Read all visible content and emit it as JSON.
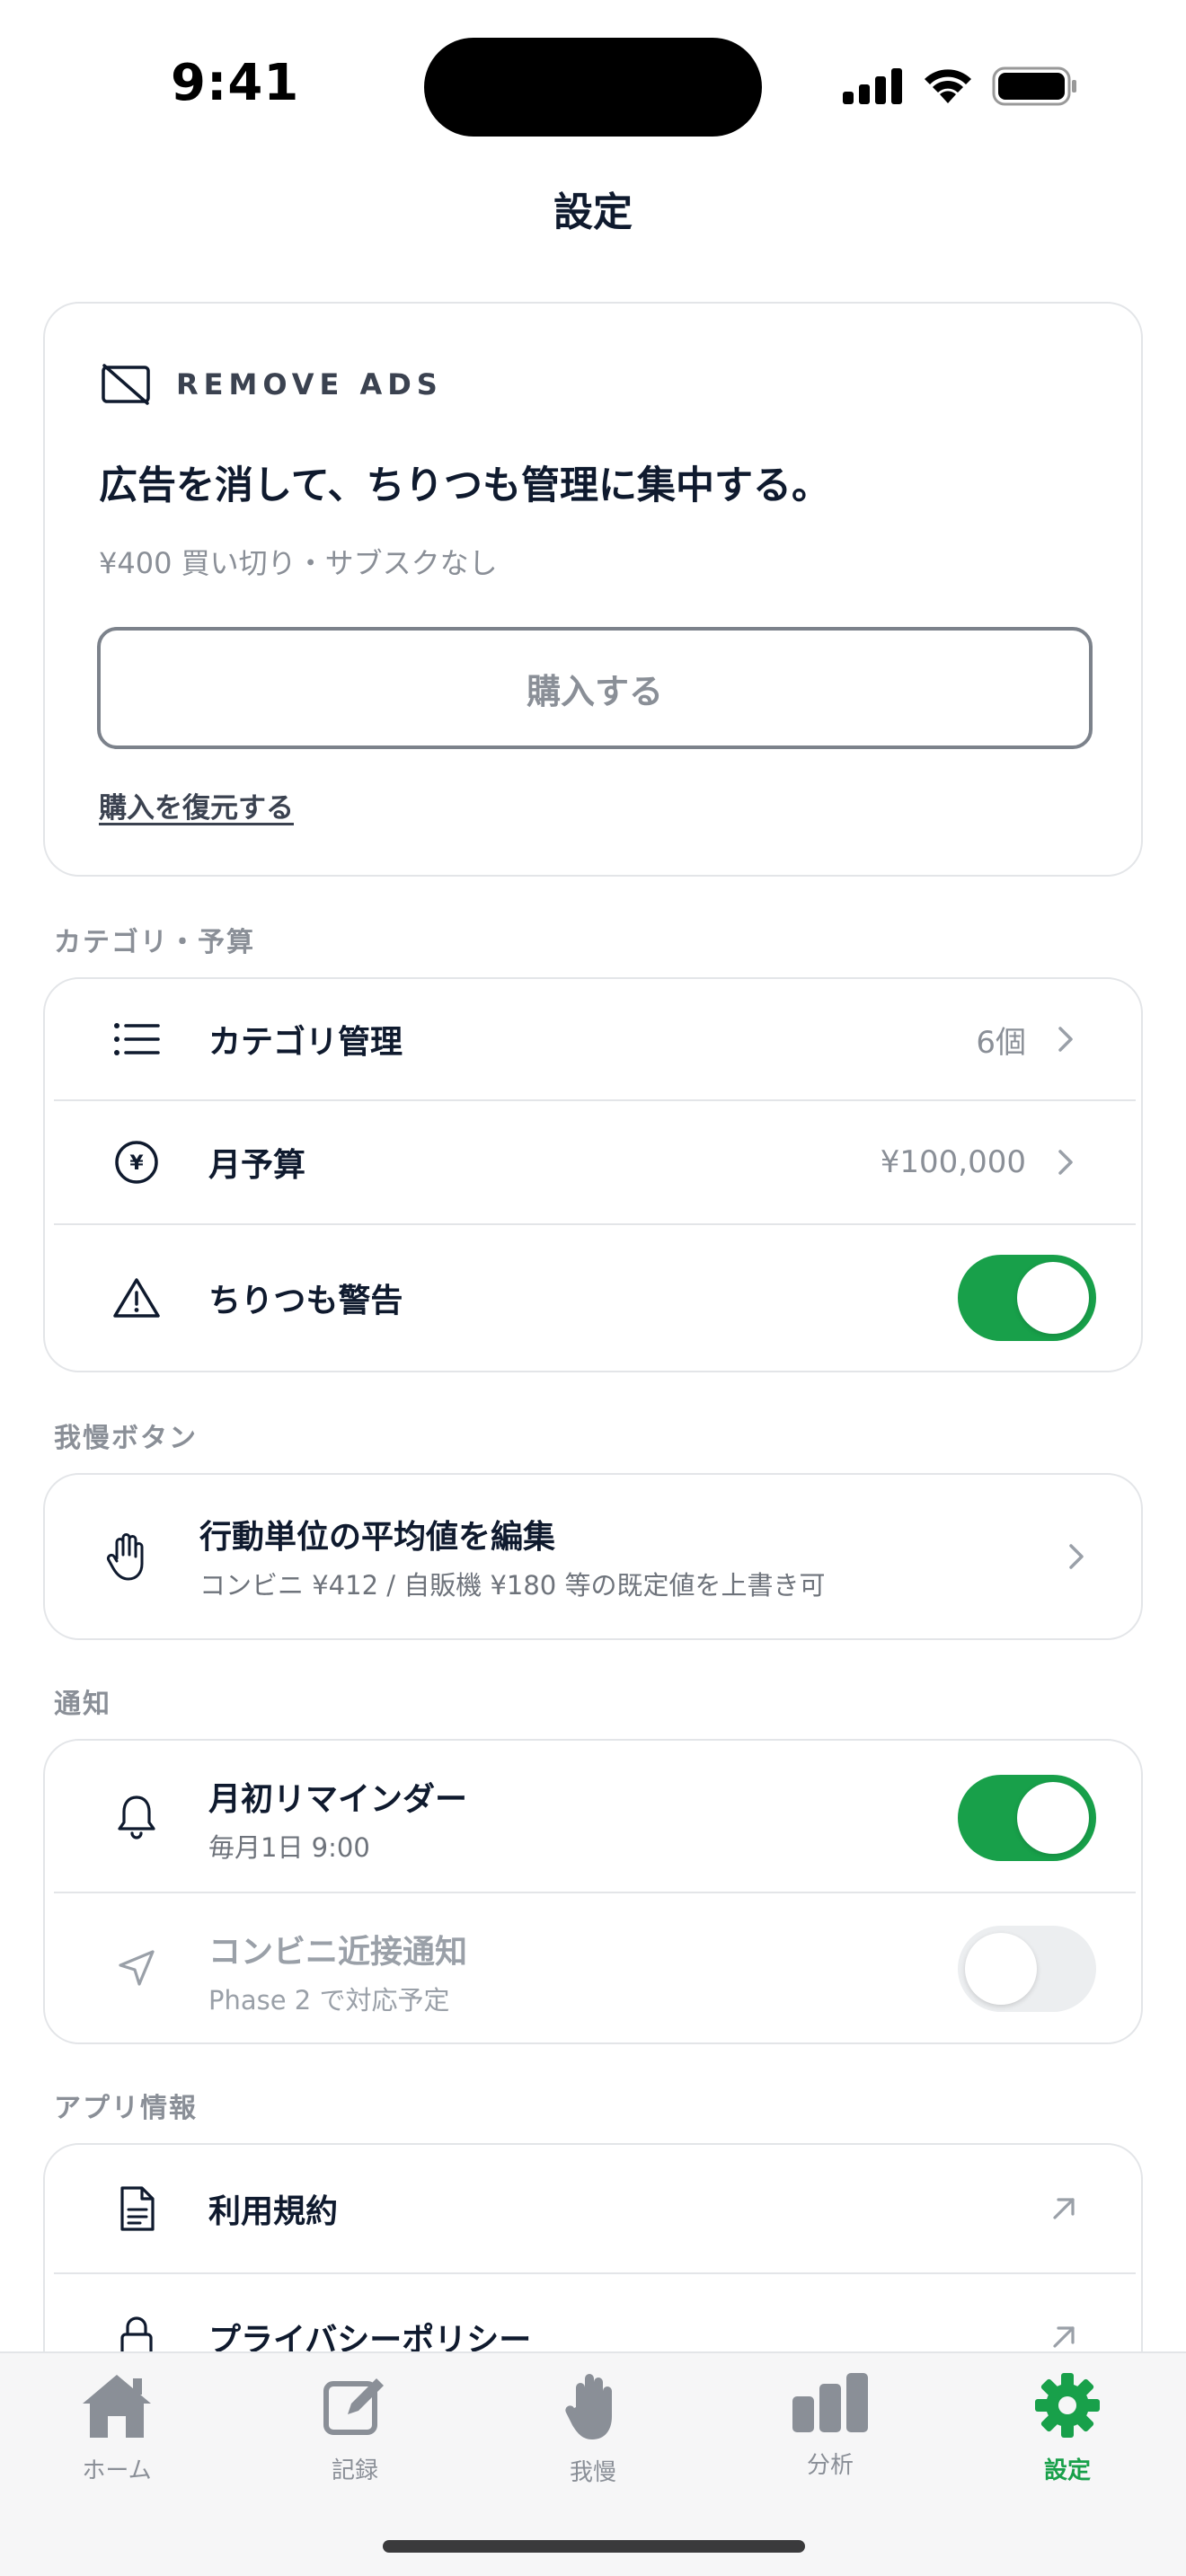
{
  "status": {
    "time": "9:41"
  },
  "header": {
    "title": "設定"
  },
  "ads": {
    "label": "REMOVE ADS",
    "title": "広告を消して、ちりつも管理に集中する。",
    "price": "¥400 買い切り・サブスクなし",
    "buy_label": "購入する",
    "restore_label": "購入を復元する"
  },
  "sections": {
    "category": "カテゴリ・予算",
    "gaman": "我慢ボタン",
    "notify": "通知",
    "appinfo": "アプリ情報"
  },
  "category_rows": {
    "category_label": "カテゴリ管理",
    "category_value": "6個",
    "budget_label": "月予算",
    "budget_value": "¥100,000",
    "warning_label": "ちりつも警告",
    "warning_on": true
  },
  "gaman_row": {
    "label": "行動単位の平均値を編集",
    "sub": "コンビニ ¥412 / 自販機 ¥180 等の既定値を上書き可"
  },
  "notify_rows": {
    "reminder_label": "月初リマインダー",
    "reminder_sub": "毎月1日 9:00",
    "reminder_on": true,
    "proximity_label": "コンビニ近接通知",
    "proximity_sub": "Phase 2 で対応予定",
    "proximity_on": false
  },
  "appinfo_rows": {
    "terms_label": "利用規約",
    "privacy_label": "プライバシーポリシー"
  },
  "tabs": [
    {
      "label": "ホーム",
      "icon": "home-icon",
      "active": false
    },
    {
      "label": "記録",
      "icon": "edit-icon",
      "active": false
    },
    {
      "label": "我慢",
      "icon": "hand-icon",
      "active": false
    },
    {
      "label": "分析",
      "icon": "bar-chart-icon",
      "active": false
    },
    {
      "label": "設定",
      "icon": "gear-icon",
      "active": true
    }
  ],
  "colors": {
    "accent": "#18a04a",
    "text": "#0f1a2e",
    "muted": "#8a8f97"
  }
}
